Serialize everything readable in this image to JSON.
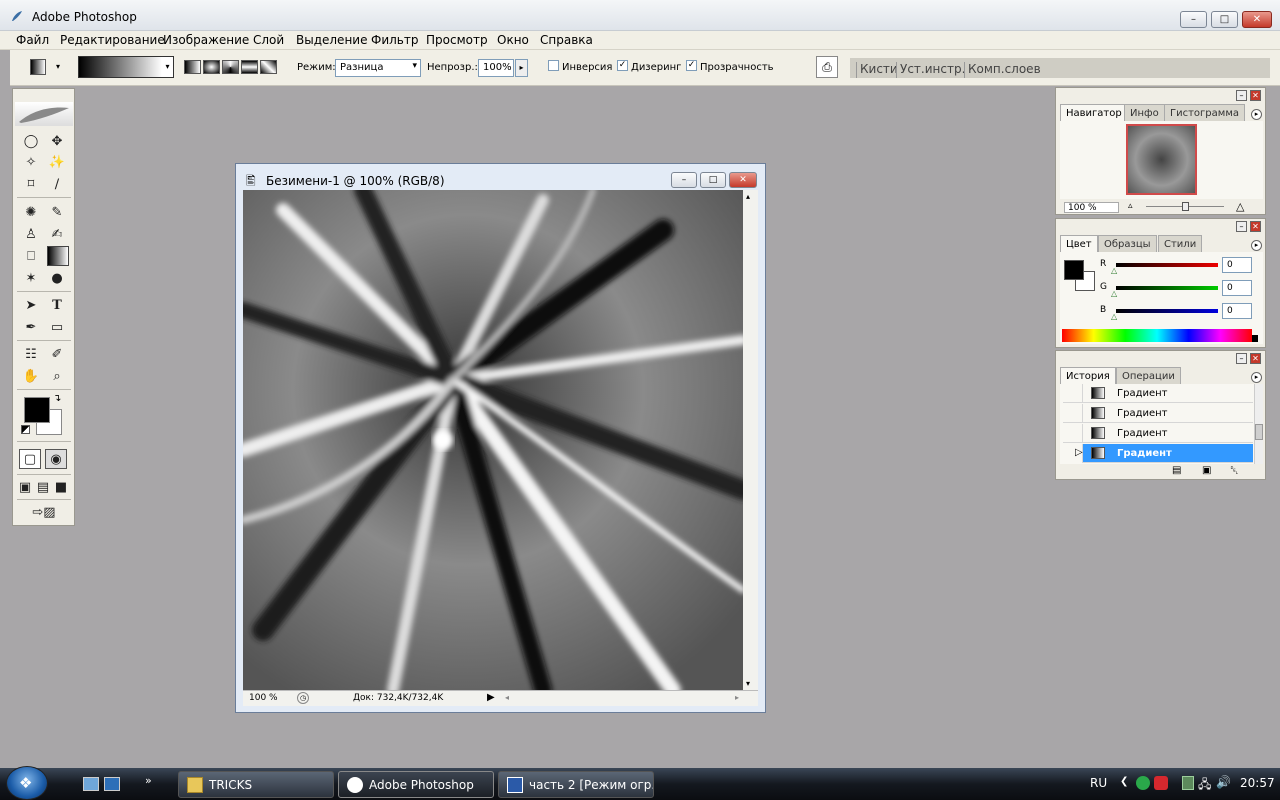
{
  "window": {
    "title": "Adobe Photoshop"
  },
  "menu": [
    "Файл",
    "Редактирование",
    "Изображение",
    "Слой",
    "Выделение",
    "Фильтр",
    "Просмотр",
    "Окно",
    "Справка"
  ],
  "options": {
    "mode_label": "Режим:",
    "mode_value": "Разница",
    "opacity_label": "Непрозр.:",
    "opacity_value": "100%",
    "reverse_label": "Инверсия",
    "reverse_checked": false,
    "dither_label": "Дизеринг",
    "dither_checked": true,
    "transparency_label": "Прозрачность",
    "transparency_checked": true,
    "palette_tabs": [
      "Кисти",
      "Уст.инстр.",
      "Комп.слоев"
    ]
  },
  "colors": {
    "foreground": "#000000",
    "background": "#ffffff",
    "accent": "#3399ff"
  },
  "document": {
    "title": "Безимени-1 @ 100% (RGB/8)",
    "zoom": "100 %",
    "doc_info": "Док: 732,4K/732,4K"
  },
  "navigator_panel": {
    "tabs": [
      "Навигатор",
      "Инфо",
      "Гистограмма"
    ],
    "zoom": "100 %"
  },
  "color_panel": {
    "tabs": [
      "Цвет",
      "Образцы",
      "Стили"
    ],
    "channels": [
      {
        "label": "R",
        "value": "0"
      },
      {
        "label": "G",
        "value": "0"
      },
      {
        "label": "B",
        "value": "0"
      }
    ]
  },
  "history_panel": {
    "tabs": [
      "История",
      "Операции"
    ],
    "items": [
      "Градиент",
      "Градиент",
      "Градиент",
      "Градиент"
    ]
  },
  "taskbar": {
    "buttons": [
      "TRICKS",
      "Adobe Photoshop",
      "часть 2 [Режим огр..."
    ],
    "lang": "RU",
    "time": "20:57",
    "chevron": "»"
  }
}
